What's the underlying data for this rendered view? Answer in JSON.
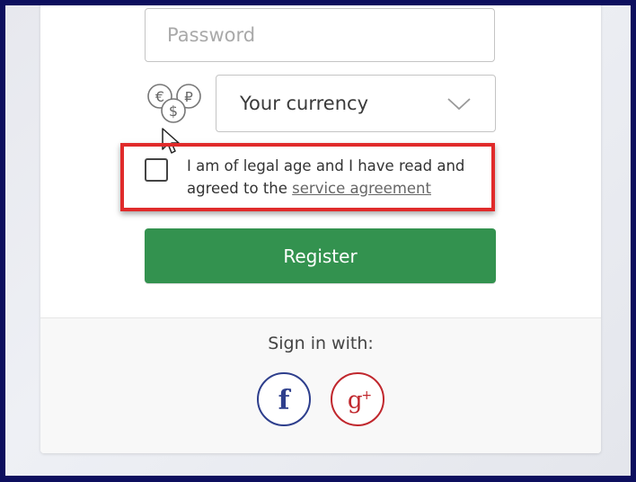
{
  "form": {
    "password": {
      "value": "",
      "placeholder": "Password"
    },
    "currency": {
      "icon": "currency-coins-icon",
      "selected": "Your currency"
    },
    "agreement": {
      "text_before": "I am of legal age and I have read and agreed to the ",
      "link_text": "service agreement",
      "checked": false
    },
    "register_label": "Register"
  },
  "social": {
    "heading": "Sign in with:",
    "providers": [
      {
        "name": "Facebook",
        "icon": "facebook-icon",
        "glyph": "f",
        "color": "#2d3e8c"
      },
      {
        "name": "Google Plus",
        "icon": "google-plus-icon",
        "glyph": "g+",
        "color": "#c0272d"
      }
    ]
  },
  "colors": {
    "accent_green": "#33924f",
    "highlight_red": "#e02b2b",
    "frame_navy": "#0d0f5e"
  }
}
